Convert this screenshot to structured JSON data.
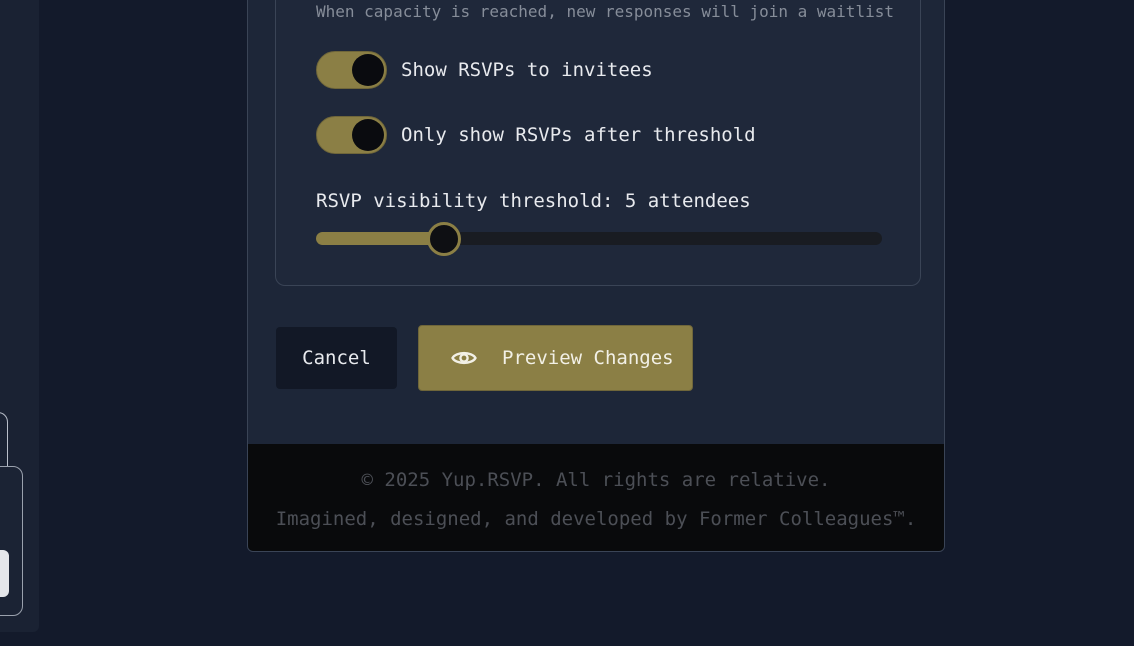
{
  "capacity_hint": "When capacity is reached, new responses will join a waitlist",
  "toggles": [
    {
      "label": "Show RSVPs to invitees",
      "on": true
    },
    {
      "label": "Only show RSVPs after threshold",
      "on": true
    }
  ],
  "threshold": {
    "label": "RSVP visibility threshold: 5 attendees",
    "value": 5,
    "fraction": 0.227
  },
  "actions": {
    "cancel_label": "Cancel",
    "preview_label": "Preview Changes",
    "preview_icon": "eye-icon"
  },
  "footer": {
    "copyright": "© 2025 Yup.RSVP. All rights are relative.",
    "credit": "Imagined, designed, and developed by Former Colleagues™."
  },
  "colors": {
    "accent": "#8b7f45",
    "background": "#131a2b",
    "card": "#1d2638",
    "footer": "#090a0c"
  }
}
